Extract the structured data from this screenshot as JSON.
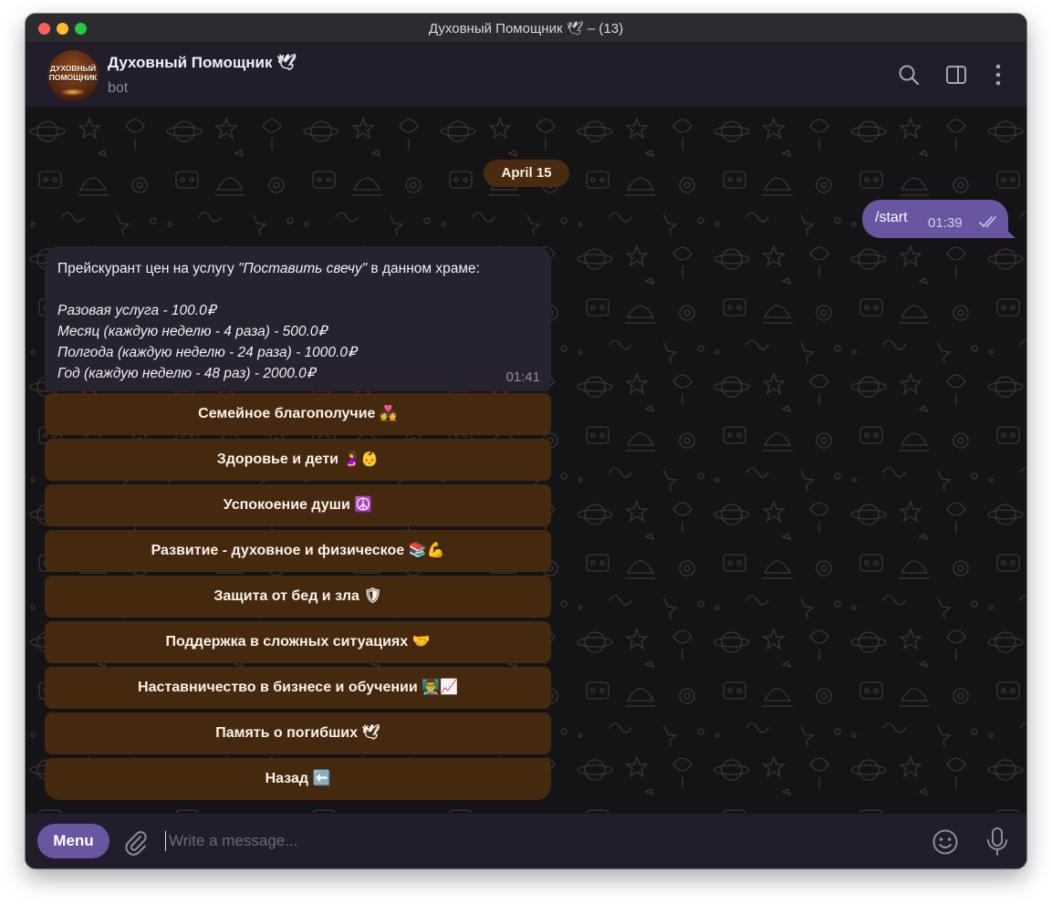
{
  "window": {
    "title": "Духовный Помощник 🕊 – (13)"
  },
  "header": {
    "avatar_text_line1": "ДУХОВНЫЙ",
    "avatar_text_line2": "ПОМОЩНИК",
    "chat_name": "Духовный Помощник 🕊",
    "status": "bot",
    "icons": [
      "search-icon",
      "sidebar-toggle-icon",
      "more-vertical-icon"
    ]
  },
  "messages": {
    "date_label": "April 15",
    "outgoing": {
      "text": "/start",
      "time": "01:39",
      "status_icon": "double-check-icon"
    },
    "incoming": {
      "intro_before": "Прейскурант цен на услугу ",
      "intro_italic": "\"Поставить свечу\"",
      "intro_after": " в данном храме:",
      "price_lines": [
        "Разовая услуга - 100.0₽",
        "Месяц (каждую неделю - 4 раза) - 500.0₽",
        "Полгода (каждую неделю - 24 раза) - 1000.0₽",
        "Год (каждую неделю - 48 раз) - 2000.0₽"
      ],
      "time": "01:41"
    },
    "keyboard": [
      "Семейное благополучие 💑",
      "Здоровье и дети 🤰👶",
      "Успокоение души ☮️",
      "Развитие - духовное и физическое 📚💪",
      "Защита от бед и зла 🛡",
      "Поддержка в сложных ситуациях 🤝",
      "Наставничество в бизнесе и обучении 👨‍🏫📈",
      "Память о погибших 🕊",
      "Назад ⬅️"
    ]
  },
  "composer": {
    "menu_label": "Menu",
    "placeholder": "Write a message...",
    "value": ""
  },
  "colors": {
    "accent": "#6a55a0",
    "keyboard_button": "#45290f",
    "date_pill": "#4a2a10",
    "incoming_bubble": "#26222f",
    "header_bg": "#211d2b",
    "chat_bg": "#141316"
  }
}
